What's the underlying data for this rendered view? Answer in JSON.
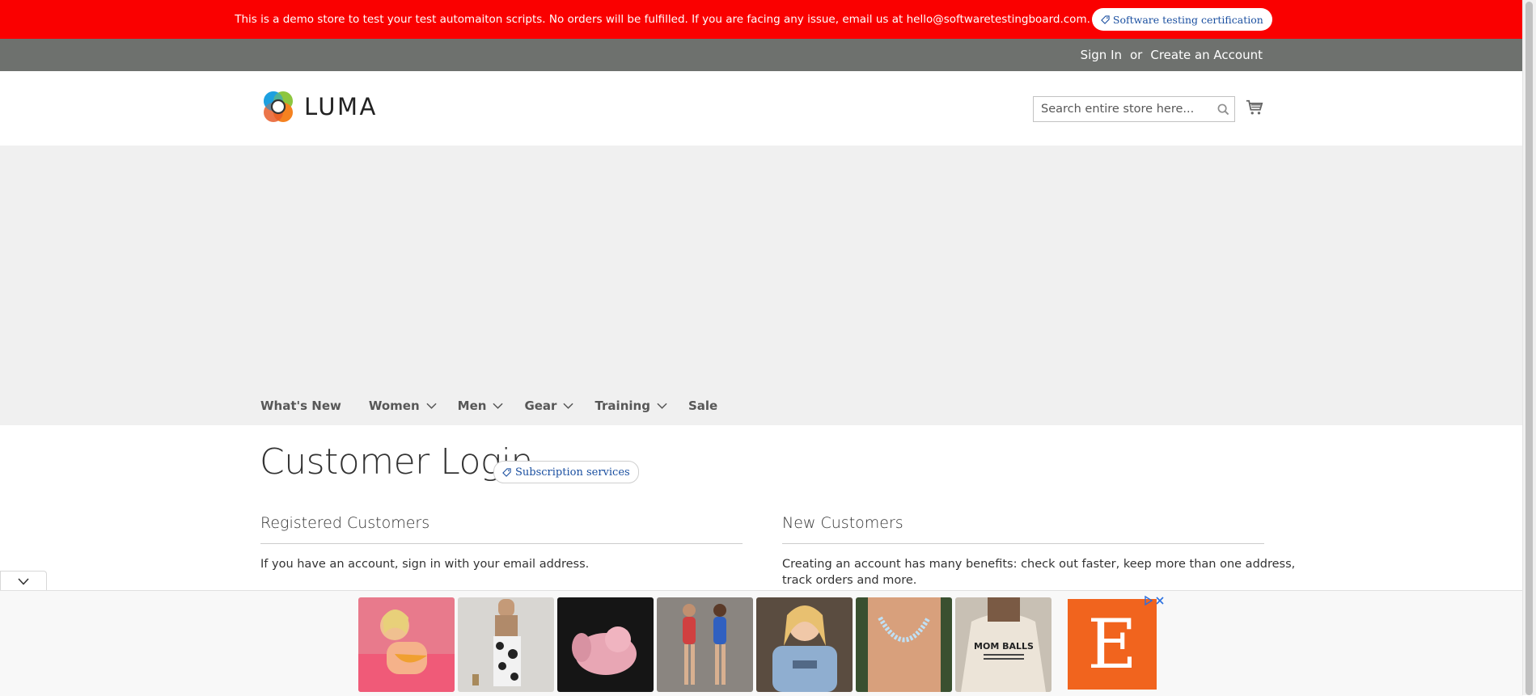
{
  "demo_bar": {
    "text": "This is a demo store to test your test automaiton scripts. No orders will be fulfilled. If you are facing any issue, email us at hello@softwaretestingboard.com.",
    "cert_link": "Software testing certification"
  },
  "top_links": {
    "sign_in": "Sign In",
    "or": "or",
    "create_account": "Create an Account"
  },
  "header": {
    "logo_text": "LUMA",
    "search_placeholder": "Search entire store here..."
  },
  "nav": {
    "items": [
      {
        "label": "What's New",
        "has_dropdown": false
      },
      {
        "label": "Women",
        "has_dropdown": true
      },
      {
        "label": "Men",
        "has_dropdown": true
      },
      {
        "label": "Gear",
        "has_dropdown": true
      },
      {
        "label": "Training",
        "has_dropdown": true
      },
      {
        "label": "Sale",
        "has_dropdown": false
      }
    ]
  },
  "main": {
    "title": "Customer Login",
    "sub_pill": "Subscription services",
    "registered": {
      "title": "Registered Customers",
      "text": "If you have an account, sign in with your email address."
    },
    "new_customers": {
      "title": "New Customers",
      "text_line1": "Creating an account has many benefits: check out faster, keep more than one address,",
      "text_line2": "track orders and more."
    }
  },
  "ad": {
    "etsy_letter": "E",
    "thumb_labels": [
      "woman-lounging",
      "patterned-pants",
      "pink-figure",
      "swimwear-models",
      "tshirt-model",
      "bead-necklace",
      "mom-balls-sweatshirt"
    ],
    "sweatshirt_text": "MOM BALLS"
  },
  "colors": {
    "demo_red": "#fa0000",
    "toplinks_gray": "#6e716e",
    "banner_gray": "#f0f0f0",
    "link_blue": "#1a4fa0",
    "etsy_orange": "#f1641e"
  }
}
